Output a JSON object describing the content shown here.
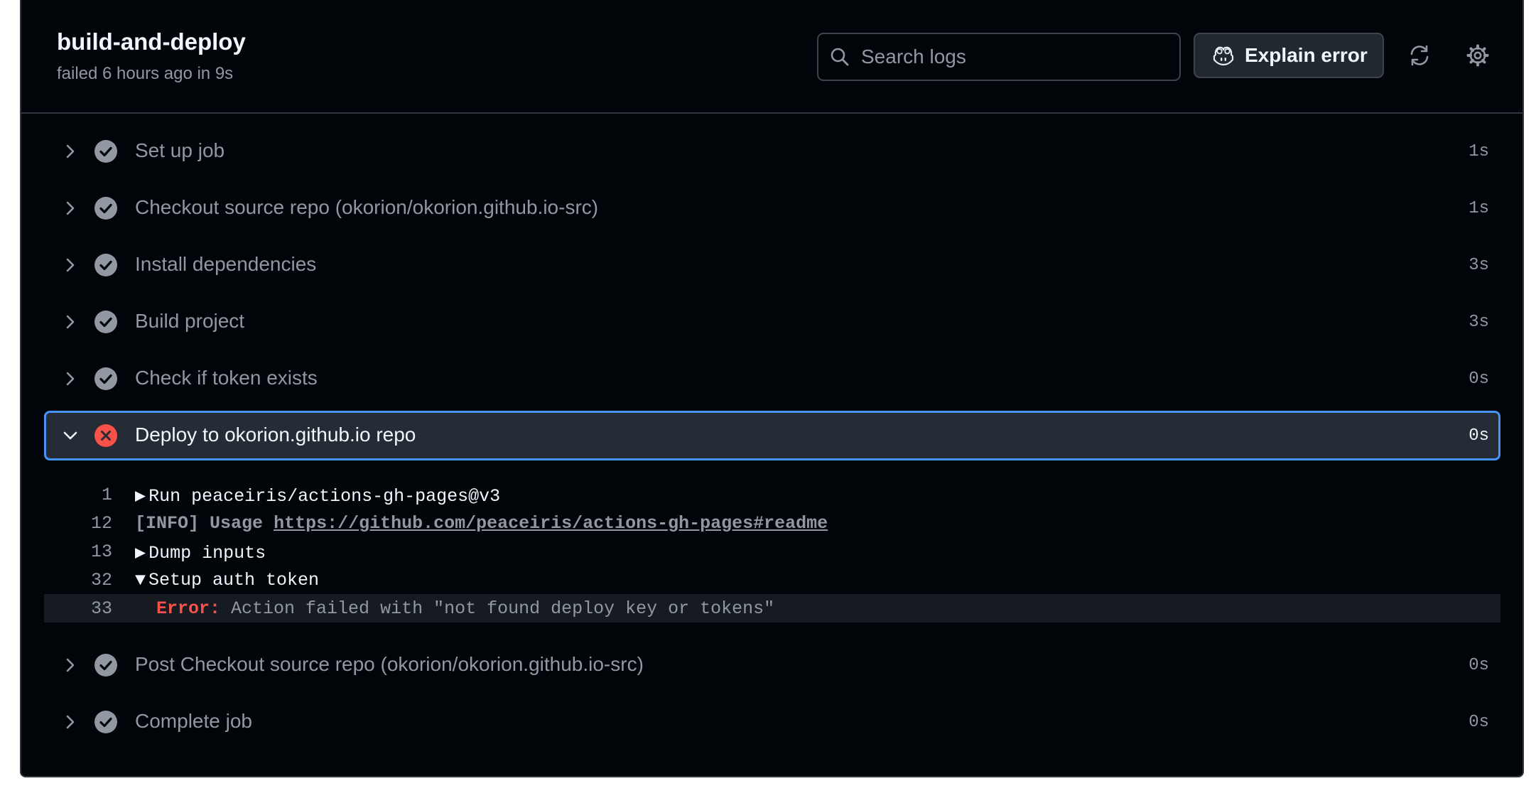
{
  "job": {
    "title": "build-and-deploy",
    "subtitle": "failed 6 hours ago in 9s"
  },
  "toolbar": {
    "search_placeholder": "Search logs",
    "explain_label": "Explain error",
    "icons": [
      "search-icon",
      "copilot-icon",
      "refresh-icon",
      "gear-icon"
    ]
  },
  "steps": [
    {
      "name": "Set up job",
      "duration": "1s",
      "status": "success"
    },
    {
      "name": "Checkout source repo (okorion/okorion.github.io-src)",
      "duration": "1s",
      "status": "success"
    },
    {
      "name": "Install dependencies",
      "duration": "3s",
      "status": "success"
    },
    {
      "name": "Build project",
      "duration": "3s",
      "status": "success"
    },
    {
      "name": "Check if token exists",
      "duration": "0s",
      "status": "success"
    },
    {
      "name": "Deploy to okorion.github.io repo",
      "duration": "0s",
      "status": "failure",
      "expanded": true
    },
    {
      "name": "Post Checkout source repo (okorion/okorion.github.io-src)",
      "duration": "0s",
      "status": "success"
    },
    {
      "name": "Complete job",
      "duration": "0s",
      "status": "success"
    }
  ],
  "log": [
    {
      "line": "1",
      "text": "Run peaceiris/actions-gh-pages@v3",
      "group": "collapsed"
    },
    {
      "line": "12",
      "info": "[INFO]",
      "usage": "Usage",
      "link": "https://github.com/peaceiris/actions-gh-pages#readme"
    },
    {
      "line": "13",
      "text": "Dump inputs",
      "group": "collapsed"
    },
    {
      "line": "32",
      "text": "Setup auth token",
      "group": "expanded"
    },
    {
      "line": "33",
      "error_label": "Error:",
      "text": "Action failed with \"not found deploy key or tokens\""
    }
  ],
  "colors": {
    "background": "#010409",
    "border": "#30363d",
    "active_border": "#4493f8",
    "success": "#9198a1",
    "failure": "#f85149"
  }
}
